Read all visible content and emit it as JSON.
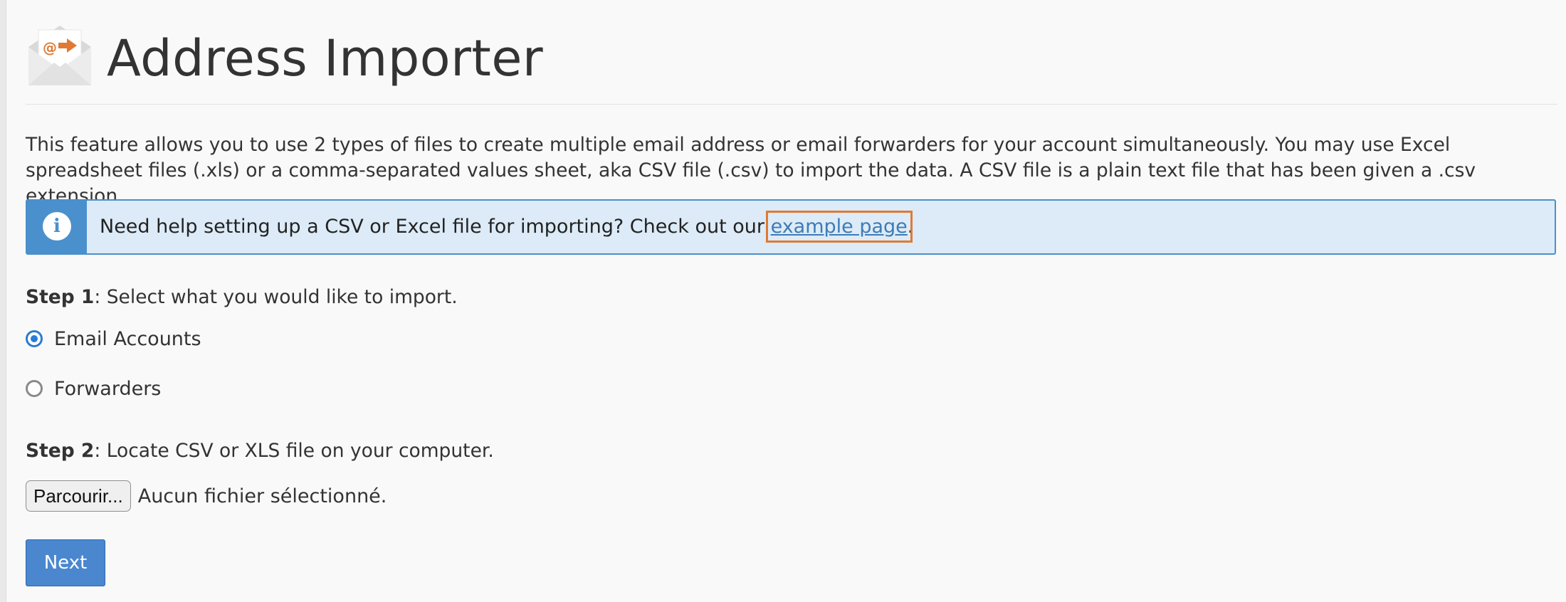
{
  "page": {
    "title": "Address Importer",
    "icon": "email-import-icon"
  },
  "description": "This feature allows you to use 2 types of files to create multiple email address or email forwarders for your account simultaneously. You may use Excel spreadsheet files (.xls) or a comma-separated values sheet, aka CSV file (.csv) to import the data. A CSV file is a plain text file that has been given a .csv extension.",
  "callout": {
    "icon": "info-icon",
    "text_before": "Need help setting up a CSV or Excel file for importing? Check out our ",
    "link_text": "example page",
    "text_after": "."
  },
  "step1": {
    "label": "Step 1",
    "text": ": Select what you would like to import.",
    "options": [
      {
        "label": "Email Accounts",
        "selected": true
      },
      {
        "label": "Forwarders",
        "selected": false
      }
    ]
  },
  "step2": {
    "label": "Step 2",
    "text": ": Locate CSV or XLS file on your computer.",
    "browse_label": "Parcourir...",
    "file_status": "Aucun fichier sélectionné."
  },
  "next_label": "Next",
  "colors": {
    "accent": "#4a90cc",
    "link": "#3e7bb6",
    "highlight": "#e07a33",
    "button": "#4a87cf"
  }
}
